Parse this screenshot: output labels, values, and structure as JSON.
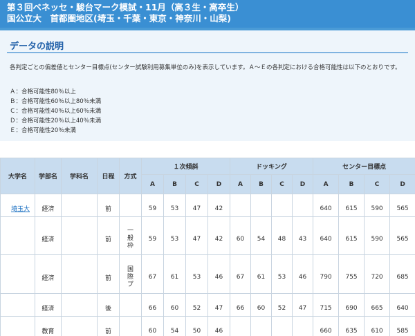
{
  "header": {
    "title_line1": "第３回ベネッセ・駿台マーク模試・11月（高３生・高卒生）",
    "title_line2": "国公立大　首都圏地区(埼玉・千葉・東京・神奈川・山梨)"
  },
  "explanation": {
    "title": "データの説明",
    "description": "各判定ごとの偏差値とセンター目標点(センター試験利用募集単位のみ)を表示しています。Ａ～Ｅの各判定における合格可能性は以下のとおりです。",
    "grades": [
      "Ａ：合格可能性80％以上",
      "Ｂ：合格可能性60％以上80％未満",
      "Ｃ：合格可能性40％以上60％未満",
      "Ｄ：合格可能性20％以上40％未満",
      "Ｅ：合格可能性20％未満"
    ]
  },
  "table": {
    "headers": {
      "university": "大学名",
      "faculty": "学部名",
      "department": "学科名",
      "schedule": "日程",
      "method": "方式",
      "group1": "１次傾斜",
      "group2": "ドッキング",
      "group3": "センター目標点",
      "grades": [
        "A",
        "B",
        "C",
        "D",
        "A",
        "B",
        "C",
        "D",
        "A",
        "B",
        "C",
        "D"
      ]
    },
    "rows": [
      {
        "university": "埼玉大",
        "faculty": "経済",
        "department": "",
        "schedule": "前",
        "method": "",
        "g1": [
          "59",
          "53",
          "47",
          "42"
        ],
        "g2": [
          "",
          "",
          "",
          ""
        ],
        "g3": [
          "640",
          "615",
          "590",
          "565"
        ]
      },
      {
        "university": "",
        "faculty": "経済",
        "department": "",
        "schedule": "前",
        "method": "一\n般\n枠",
        "g1": [
          "59",
          "53",
          "47",
          "42"
        ],
        "g2": [
          "60",
          "54",
          "48",
          "43"
        ],
        "g3": [
          "640",
          "615",
          "590",
          "565"
        ]
      },
      {
        "university": "",
        "faculty": "経済",
        "department": "",
        "schedule": "前",
        "method": "国\n際\nプ",
        "g1": [
          "67",
          "61",
          "53",
          "46"
        ],
        "g2": [
          "67",
          "61",
          "53",
          "46"
        ],
        "g3": [
          "790",
          "755",
          "720",
          "685"
        ]
      },
      {
        "university": "",
        "faculty": "経済",
        "department": "",
        "schedule": "後",
        "method": "",
        "g1": [
          "66",
          "60",
          "52",
          "47"
        ],
        "g2": [
          "66",
          "60",
          "52",
          "47"
        ],
        "g3": [
          "715",
          "690",
          "665",
          "640"
        ]
      },
      {
        "university": "",
        "faculty": "教育",
        "department": "",
        "schedule": "前",
        "method": "",
        "g1": [
          "60",
          "54",
          "50",
          "46"
        ],
        "g2": [
          "",
          "",
          "",
          ""
        ],
        "g3": [
          "660",
          "635",
          "610",
          "585"
        ]
      }
    ]
  }
}
